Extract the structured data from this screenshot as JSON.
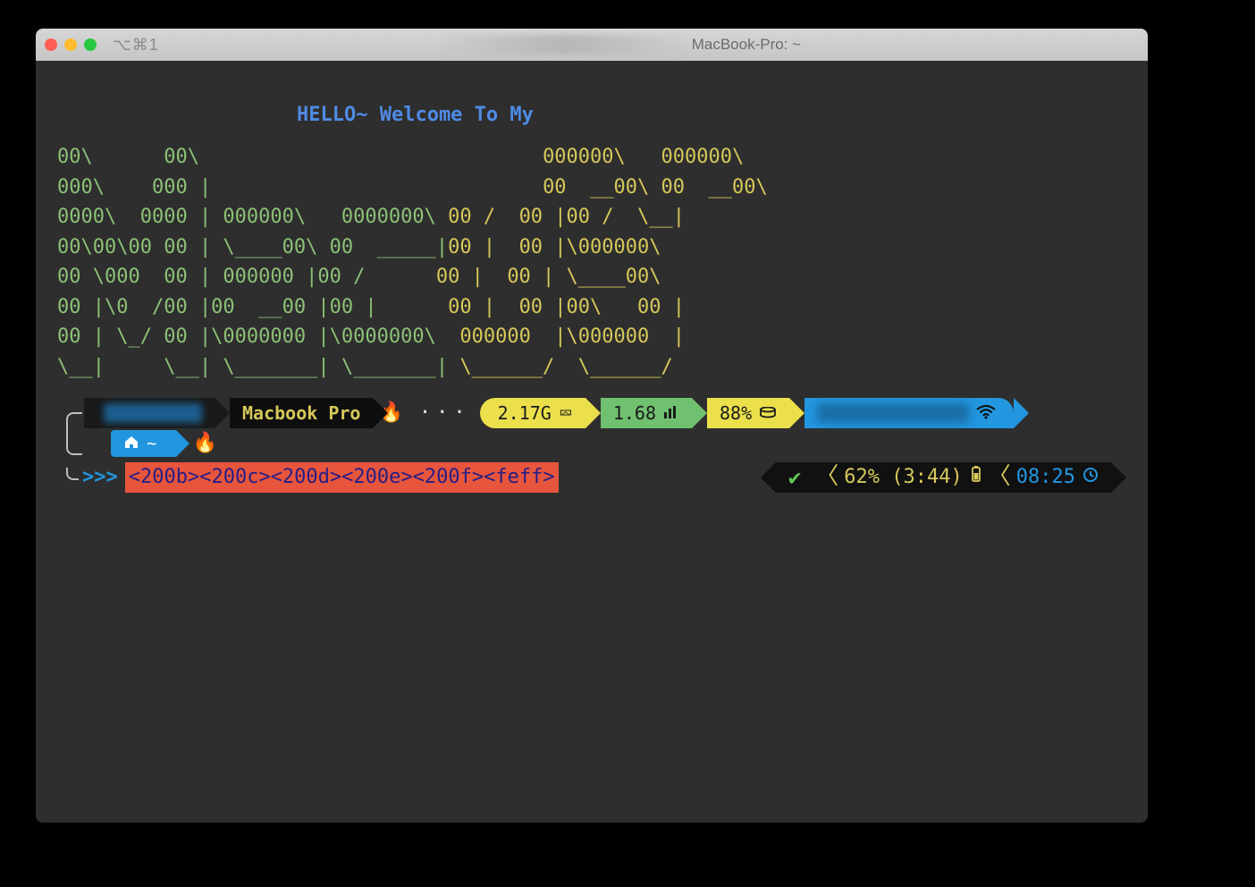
{
  "window": {
    "shortcut": "⌥⌘1",
    "title_suffix": "MacBook-Pro: ~"
  },
  "motd": {
    "welcome": "HELLO~ Welcome To My",
    "ascii": [
      {
        "l": "00\\      00\\                             ",
        "r": "000000\\   000000\\ "
      },
      {
        "l": "000\\    000 |                            ",
        "r": "00  __00\\ 00  __00\\ "
      },
      {
        "l": "0000\\  0000 | 000000\\   0000000\\ ",
        "r": "00 /  00 |00 /  \\__|"
      },
      {
        "l": "00\\00\\00 00 | \\____00\\ 00  _____|",
        "r": "00 |  00 |\\000000\\ "
      },
      {
        "l": "00 \\000  00 | 000000 |00 /      ",
        "r": "00 |  00 | \\____00\\ "
      },
      {
        "l": "00 |\\0  /00 |00  __00 |00 |      ",
        "r": "00 |  00 |00\\   00 |"
      },
      {
        "l": "00 | \\_/ 00 |\\0000000 |\\0000000\\ ",
        "r": " 000000  |\\000000  |"
      },
      {
        "l": "\\__|     \\__| \\_______| \\_______|",
        "r": " \\______/  \\______/ "
      }
    ]
  },
  "status_top": {
    "host": "Macbook Pro",
    "ram": "2.17G",
    "load": "1.68",
    "disk": "88%"
  },
  "cwd": {
    "path": "~"
  },
  "prompt": {
    "symbol": ">>>",
    "input": "<200b><200c><200d><200e><200f><feff>"
  },
  "status_right": {
    "battery": "62% (3:44)",
    "time": "08:25"
  }
}
